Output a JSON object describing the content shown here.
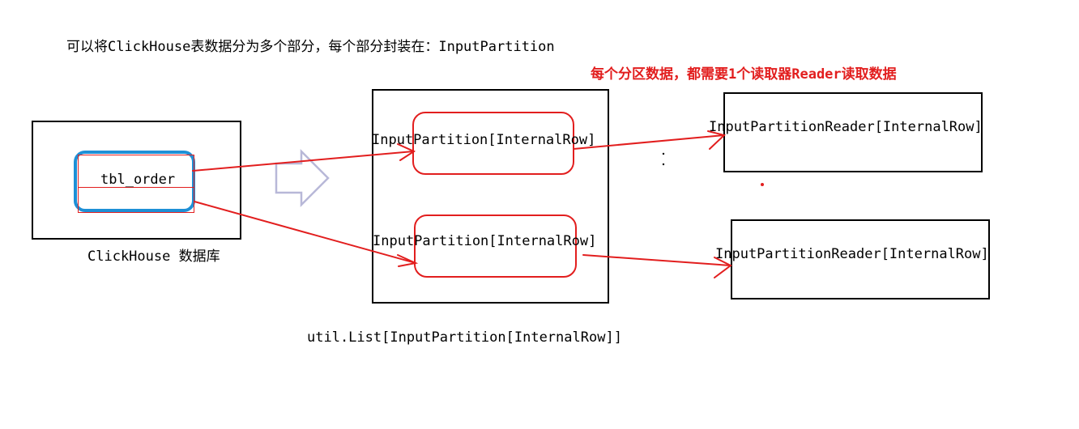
{
  "diagram": {
    "title": "可以将ClickHouse表数据分为多个部分，每个部分封装在：InputPartition",
    "subtitle": "每个分区数据，都需要1个读取器Reader读取数据",
    "database_label": "ClickHouse 数据库",
    "table_label": "tbl_order",
    "list_label": "util.List[InputPartition[InternalRow]]",
    "partitions": [
      {
        "label": "InputPartition[InternalRow]"
      },
      {
        "label": "InputPartition[InternalRow]"
      }
    ],
    "readers": [
      {
        "label": "InputPartitionReader[InternalRow]"
      },
      {
        "label": "InputPartitionReader[InternalRow]"
      }
    ],
    "colors": {
      "arrow": "#e21e1e",
      "table_outline": "#1e90d6",
      "hollow_arrow": "#b8b8d8",
      "box_border": "#000000"
    }
  }
}
